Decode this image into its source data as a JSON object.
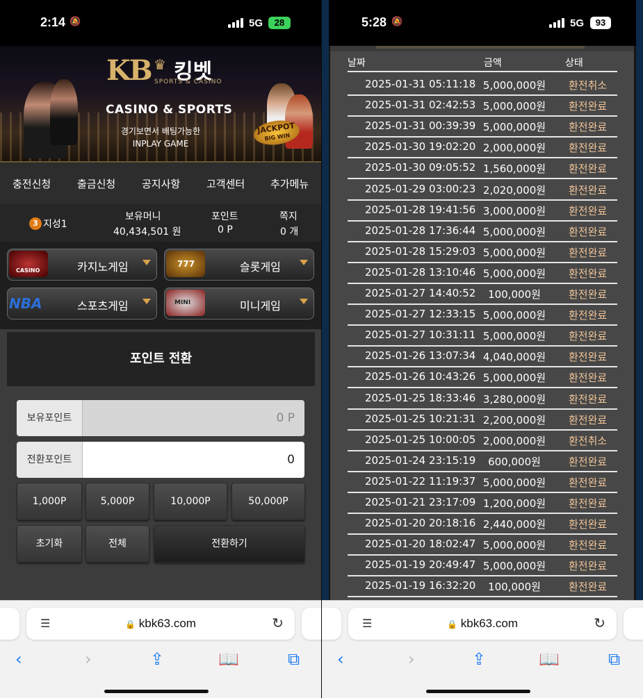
{
  "left": {
    "status": {
      "time": "2:14",
      "network": "5G",
      "battery": "28"
    },
    "banner": {
      "logo_mark": "KB",
      "brand": "킹벳",
      "brand_sub": "SPORTS & CASINO",
      "title": "CASINO & SPORTS",
      "line1": "경기보면서 배팅가능한",
      "line2": "INPLAY GAME",
      "jackpot1": "JACKPOT",
      "jackpot2": "BIG WIN"
    },
    "nav": [
      "충전신청",
      "출금신청",
      "공지사항",
      "고객센터",
      "추가메뉴"
    ],
    "user": {
      "level": "3",
      "name": "지성1",
      "money_label": "보유머니",
      "money": "40,434,501 원",
      "point_label": "포인트",
      "point": "0 P",
      "msg_label": "쪽지",
      "msg": "0 개"
    },
    "games": [
      "카지노게임",
      "슬롯게임",
      "스포츠게임",
      "미니게임"
    ],
    "game_icons": [
      "CASINO",
      "777",
      "NBA",
      "MINI"
    ],
    "points": {
      "title": "포인트 전환",
      "held_label": "보유포인트",
      "held_value": "0 P",
      "convert_label": "전환포인트",
      "convert_value": "0",
      "amounts": [
        "1,000P",
        "5,000P",
        "10,000P",
        "50,000P"
      ],
      "reset": "초기화",
      "all": "전체",
      "convert": "전환하기"
    },
    "safari": {
      "url": "kbk63.com"
    }
  },
  "right": {
    "status": {
      "time": "5:28",
      "network": "5G",
      "battery": "93"
    },
    "table": {
      "headers": [
        "날짜",
        "금액",
        "상태"
      ],
      "rows": [
        {
          "date": "2025-01-31 05:11:18",
          "amount": "5,000,000원",
          "status": "환전취소"
        },
        {
          "date": "2025-01-31 02:42:53",
          "amount": "5,000,000원",
          "status": "환전완료"
        },
        {
          "date": "2025-01-31 00:39:39",
          "amount": "5,000,000원",
          "status": "환전완료"
        },
        {
          "date": "2025-01-30 19:02:20",
          "amount": "2,000,000원",
          "status": "환전완료"
        },
        {
          "date": "2025-01-30 09:05:52",
          "amount": "1,560,000원",
          "status": "환전완료"
        },
        {
          "date": "2025-01-29 03:00:23",
          "amount": "2,020,000원",
          "status": "환전완료"
        },
        {
          "date": "2025-01-28 19:41:56",
          "amount": "3,000,000원",
          "status": "환전완료"
        },
        {
          "date": "2025-01-28 17:36:44",
          "amount": "5,000,000원",
          "status": "환전완료"
        },
        {
          "date": "2025-01-28 15:29:03",
          "amount": "5,000,000원",
          "status": "환전완료"
        },
        {
          "date": "2025-01-28 13:10:46",
          "amount": "5,000,000원",
          "status": "환전완료"
        },
        {
          "date": "2025-01-27 14:40:52",
          "amount": "100,000원",
          "status": "환전완료"
        },
        {
          "date": "2025-01-27 12:33:15",
          "amount": "5,000,000원",
          "status": "환전완료"
        },
        {
          "date": "2025-01-27 10:31:11",
          "amount": "5,000,000원",
          "status": "환전완료"
        },
        {
          "date": "2025-01-26 13:07:34",
          "amount": "4,040,000원",
          "status": "환전완료"
        },
        {
          "date": "2025-01-26 10:43:26",
          "amount": "5,000,000원",
          "status": "환전완료"
        },
        {
          "date": "2025-01-25 18:33:46",
          "amount": "3,280,000원",
          "status": "환전완료"
        },
        {
          "date": "2025-01-25 10:21:31",
          "amount": "2,200,000원",
          "status": "환전완료"
        },
        {
          "date": "2025-01-25 10:00:05",
          "amount": "2,000,000원",
          "status": "환전취소"
        },
        {
          "date": "2025-01-24 23:15:19",
          "amount": "600,000원",
          "status": "환전완료"
        },
        {
          "date": "2025-01-22 11:19:37",
          "amount": "5,000,000원",
          "status": "환전완료"
        },
        {
          "date": "2025-01-21 23:17:09",
          "amount": "1,200,000원",
          "status": "환전완료"
        },
        {
          "date": "2025-01-20 20:18:16",
          "amount": "2,440,000원",
          "status": "환전완료"
        },
        {
          "date": "2025-01-20 18:02:47",
          "amount": "5,000,000원",
          "status": "환전완료"
        },
        {
          "date": "2025-01-19 20:49:47",
          "amount": "5,000,000원",
          "status": "환전완료"
        },
        {
          "date": "2025-01-19 16:32:20",
          "amount": "100,000원",
          "status": "환전완료"
        }
      ]
    },
    "safari": {
      "url": "kbk63.com"
    }
  },
  "colors": {
    "gold": "#d7b26a",
    "status_text": "#f1c59a",
    "safari_blue": "#1f7cf0"
  },
  "icons": [
    "bell-slash-icon",
    "signal-icon",
    "battery-icon",
    "reader-icon",
    "lock-icon",
    "reload-icon",
    "back-icon",
    "forward-icon",
    "share-icon",
    "bookmarks-icon",
    "tabs-icon",
    "arrow-down-icon"
  ]
}
